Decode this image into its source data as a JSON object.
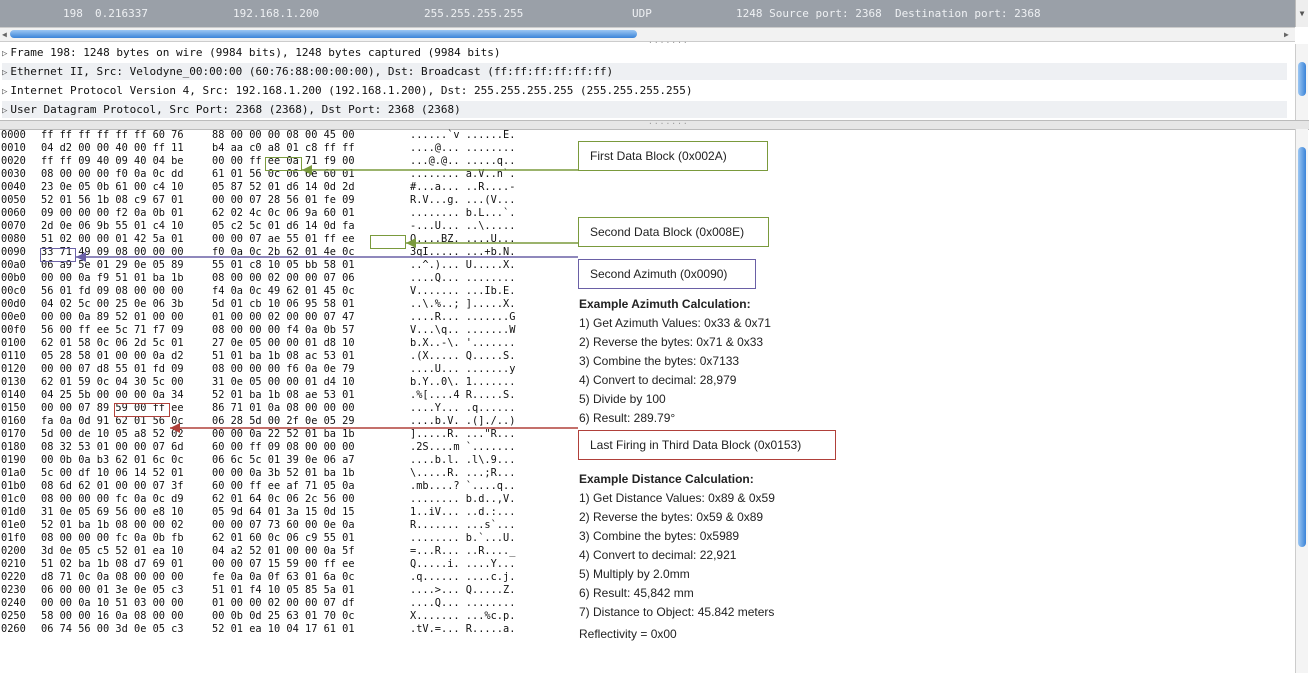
{
  "packet_row": {
    "no": "198",
    "time": "0.216337",
    "source": "192.168.1.200",
    "destination": "255.255.255.255",
    "protocol": "UDP",
    "info": "1248 Source port: 2368  Destination port: 2368"
  },
  "details": [
    "Frame 198: 1248 bytes on wire (9984 bits), 1248 bytes captured (9984 bits)",
    "Ethernet II, Src: Velodyne_00:00:00 (60:76:88:00:00:00), Dst: Broadcast (ff:ff:ff:ff:ff:ff)",
    "Internet Protocol Version 4, Src: 192.168.1.200 (192.168.1.200), Dst: 255.255.255.255 (255.255.255.255)",
    "User Datagram Protocol, Src Port: 2368 (2368), Dst Port: 2368 (2368)"
  ],
  "hex_rows": [
    [
      "0000",
      "ff ff ff ff ff ff 60 76",
      "88 00 00 00 08 00 45 00",
      "......`v ......E."
    ],
    [
      "0010",
      "04 d2 00 00 40 00 ff 11",
      "b4 aa c0 a8 01 c8 ff ff",
      "....@... ........"
    ],
    [
      "0020",
      "ff ff 09 40 09 40 04 be",
      "00 00 ff ee 0a 71 f9 00",
      "...@.@.. .....q.."
    ],
    [
      "0030",
      "08 00 00 00 f0 0a 0c dd",
      "61 01 56 0c 06 6e 60 01",
      "........ a.V..n`."
    ],
    [
      "0040",
      "23 0e 05 0b 61 00 c4 10",
      "05 87 52 01 d6 14 0d 2d",
      "#...a... ..R....-"
    ],
    [
      "0050",
      "52 01 56 1b 08 c9 67 01",
      "00 00 07 28 56 01 fe 09",
      "R.V...g. ...(V..."
    ],
    [
      "0060",
      "09 00 00 00 f2 0a 0b 01",
      "62 02 4c 0c 06 9a 60 01",
      "........ b.L...`."
    ],
    [
      "0070",
      "2d 0e 06 9b 55 01 c4 10",
      "05 c2 5c 01 d6 14 0d fa",
      "-...U... ..\\....."
    ],
    [
      "0080",
      "51 02 00 00 01 42 5a 01",
      "00 00 07 ae 55 01 ff ee",
      "Q....BZ. ....U..."
    ],
    [
      "0090",
      "33 71 49 09 08 00 00 00",
      "f0 0a 0c 2b 62 01 4e 0c",
      "3qI..... ...+b.N."
    ],
    [
      "00a0",
      "06 a9 5e 01 29 0e 05 89",
      "55 01 c8 10 05 bb 58 01",
      "..^.)... U.....X."
    ],
    [
      "00b0",
      "00 00 0a f9 51 01 ba 1b",
      "08 00 00 02 00 00 07 06",
      "....Q... ........"
    ],
    [
      "00c0",
      "56 01 fd 09 08 00 00 00",
      "f4 0a 0c 49 62 01 45 0c",
      "V....... ...Ib.E."
    ],
    [
      "00d0",
      "04 02 5c 00 25 0e 06 3b",
      "5d 01 cb 10 06 95 58 01",
      "..\\.%..; ].....X."
    ],
    [
      "00e0",
      "00 00 0a 89 52 01 00 00",
      "01 00 00 02 00 00 07 47",
      "....R... .......G"
    ],
    [
      "00f0",
      "56 00 ff ee 5c 71 f7 09",
      "08 00 00 00 f4 0a 0b 57",
      "V...\\q.. .......W"
    ],
    [
      "0100",
      "62 01 58 0c 06 2d 5c 01",
      "27 0e 05 00 00 01 d8 10",
      "b.X..-\\. '......."
    ],
    [
      "0110",
      "05 28 58 01 00 00 0a d2",
      "51 01 ba 1b 08 ac 53 01",
      ".(X..... Q.....S."
    ],
    [
      "0120",
      "00 00 07 d8 55 01 fd 09",
      "08 00 00 00 f6 0a 0e 79",
      "....U... .......y"
    ],
    [
      "0130",
      "62 01 59 0c 04 30 5c 00",
      "31 0e 05 00 00 01 d4 10",
      "b.Y..0\\. 1......."
    ],
    [
      "0140",
      "04 25 5b 00 00 00 0a 34",
      "52 01 ba 1b 08 ae 53 01",
      ".%[....4 R.....S."
    ],
    [
      "0150",
      "00 00 07 89 59 00 ff ee",
      "86 71 01 0a 08 00 00 00",
      "....Y... .q......"
    ],
    [
      "0160",
      "fa 0a 0d 91 62 01 56 0c",
      "06 28 5d 00 2f 0e 05 29",
      "....b.V. .(]./..)"
    ],
    [
      "0170",
      "5d 00 de 10 05 a8 52 02",
      "00 00 0a 22 52 01 ba 1b",
      "].....R. ...\"R..."
    ],
    [
      "0180",
      "08 32 53 01 00 00 07 6d",
      "60 00 ff 09 08 00 00 00",
      ".2S....m `......."
    ],
    [
      "0190",
      "00 0b 0a b3 62 01 6c 0c",
      "06 6c 5c 01 39 0e 06 a7",
      "....b.l. .l\\.9..."
    ],
    [
      "01a0",
      "5c 00 df 10 06 14 52 01",
      "00 00 0a 3b 52 01 ba 1b",
      "\\.....R. ...;R..."
    ],
    [
      "01b0",
      "08 6d 62 01 00 00 07 3f",
      "60 00 ff ee af 71 05 0a",
      ".mb....? `....q.."
    ],
    [
      "01c0",
      "08 00 00 00 fc 0a 0c d9",
      "62 01 64 0c 06 2c 56 00",
      "........ b.d..,V."
    ],
    [
      "01d0",
      "31 0e 05 69 56 00 e8 10",
      "05 9d 64 01 3a 15 0d 15",
      "1..iV... ..d.:..."
    ],
    [
      "01e0",
      "52 01 ba 1b 08 00 00 02",
      "00 00 07 73 60 00 0e 0a",
      "R....... ...s`..."
    ],
    [
      "01f0",
      "08 00 00 00 fc 0a 0b fb",
      "62 01 60 0c 06 c9 55 01",
      "........ b.`...U."
    ],
    [
      "0200",
      "3d 0e 05 c5 52 01 ea 10",
      "04 a2 52 01 00 00 0a 5f",
      "=...R... ..R...._"
    ],
    [
      "0210",
      "51 02 ba 1b 08 d7 69 01",
      "00 00 07 15 59 00 ff ee",
      "Q.....i. ....Y..."
    ],
    [
      "0220",
      "d8 71 0c 0a 08 00 00 00",
      "fe 0a 0a 0f 63 01 6a 0c",
      ".q...... ....c.j."
    ],
    [
      "0230",
      "06 00 00 01 3e 0e 05 c3",
      "51 01 f4 10 05 85 5a 01",
      "....>... Q.....Z."
    ],
    [
      "0240",
      "00 00 0a 10 51 03 00 00",
      "01 00 00 02 00 00 07 df",
      "....Q... ........"
    ],
    [
      "0250",
      "58 00 00 16 0a 08 00 00",
      "00 0b 0d 25 63 01 70 0c",
      "X....... ...%c.p."
    ],
    [
      "0260",
      "06 74 56 00 3d 0e 05 c3",
      "52 01 ea 10 04 17 61 01",
      ".tV.=... R.....a."
    ]
  ],
  "annotations": {
    "first_block": "First Data Block (0x002A)",
    "second_block": "Second Data Block (0x008E)",
    "second_azimuth": "Second Azimuth (0x0090)",
    "last_firing": "Last Firing in Third Data Block (0x0153)"
  },
  "azimuth_calc": {
    "title": "Example Azimuth Calculation:",
    "steps": [
      "1) Get Azimuth Values: 0x33 & 0x71",
      "2) Reverse the bytes: 0x71 & 0x33",
      "3) Combine the bytes: 0x7133",
      "4) Convert to decimal: 28,979",
      "5) Divide by 100",
      "6) Result: 289.79°"
    ]
  },
  "distance_calc": {
    "title": "Example Distance Calculation:",
    "steps": [
      "1) Get Distance Values: 0x89 & 0x59",
      "2) Reverse the bytes: 0x59 & 0x89",
      "3) Combine the bytes: 0x5989",
      "4) Convert to decimal: 22,921",
      "5) Multiply by 2.0mm",
      "6) Result: 45,842 mm",
      "7) Distance to Object: 45.842 meters"
    ]
  },
  "reflectivity": "Reflectivity = 0x00",
  "colors": {
    "green": "#7a9a3c",
    "purple": "#6a60a6",
    "red": "#b0403a",
    "selected_row": "#9aa0a8"
  }
}
